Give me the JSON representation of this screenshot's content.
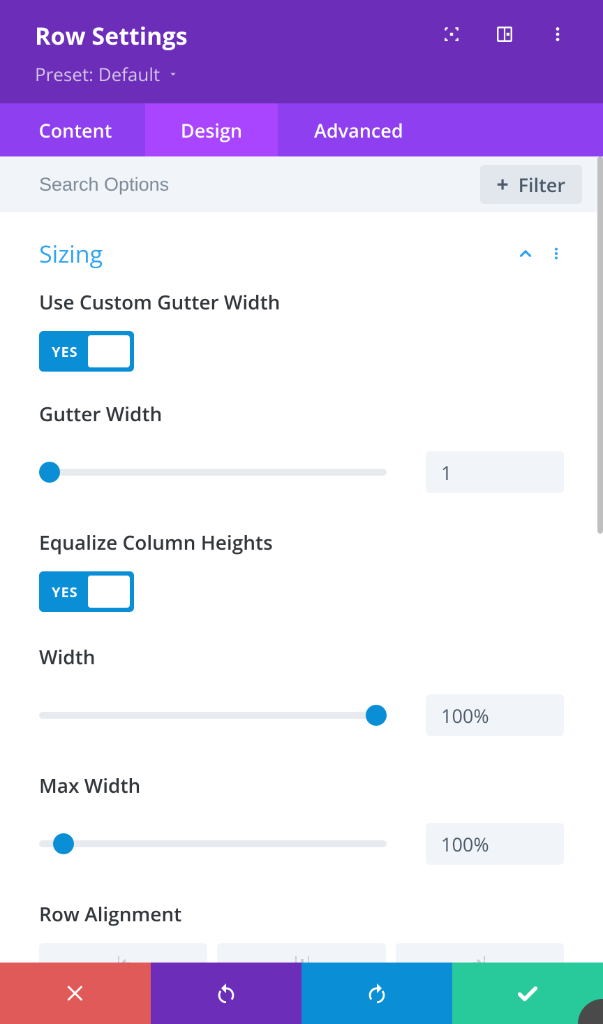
{
  "header": {
    "title": "Row Settings",
    "preset_label": "Preset: Default"
  },
  "tabs": {
    "content": "Content",
    "design": "Design",
    "advanced": "Advanced"
  },
  "search": {
    "placeholder": "Search Options",
    "filter_label": "Filter"
  },
  "section": {
    "title": "Sizing"
  },
  "fields": {
    "custom_gutter": {
      "label": "Use Custom Gutter Width",
      "toggle_text": "YES",
      "enabled": true
    },
    "gutter_width": {
      "label": "Gutter Width",
      "value": "1",
      "thumb_pct": 3
    },
    "equalize": {
      "label": "Equalize Column Heights",
      "toggle_text": "YES",
      "enabled": true
    },
    "width": {
      "label": "Width",
      "value": "100%",
      "thumb_pct": 97
    },
    "max_width": {
      "label": "Max Width",
      "value": "100%",
      "thumb_pct": 7
    },
    "row_alignment": {
      "label": "Row Alignment"
    }
  }
}
